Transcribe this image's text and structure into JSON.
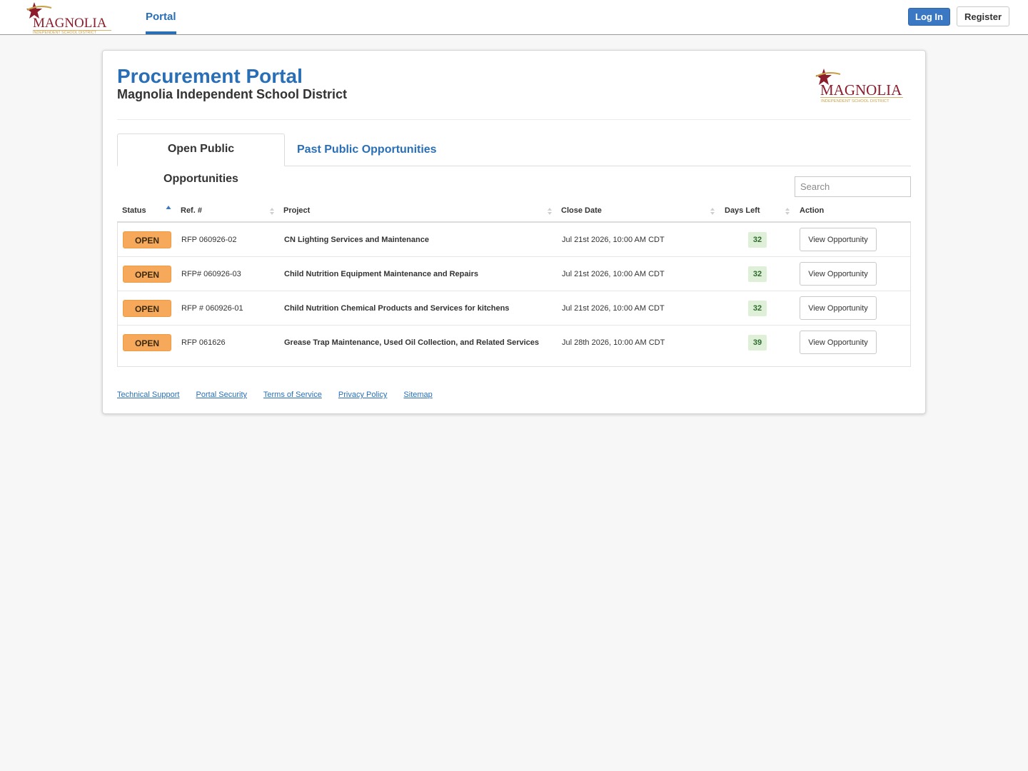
{
  "topnav": {
    "logo": {
      "name": "MAGNOLIA",
      "tagline": "INDEPENDENT SCHOOL DISTRICT"
    },
    "portal_link": "Portal",
    "login_label": "Log In",
    "register_label": "Register"
  },
  "header": {
    "title": "Procurement Portal",
    "subtitle": "Magnolia Independent School District"
  },
  "tabs": [
    {
      "label": "Open Public Opportunities",
      "active": true
    },
    {
      "label": "Past Public Opportunities",
      "active": false
    }
  ],
  "search": {
    "placeholder": "Search",
    "value": ""
  },
  "table": {
    "columns": [
      "Status",
      "Ref. #",
      "Project",
      "Close Date",
      "Days Left",
      "Action"
    ],
    "sorted_column": "Status",
    "sort_direction": "ascending",
    "rows": [
      {
        "status": "OPEN",
        "ref": "RFP 060926-02",
        "project": "CN Lighting Services and Maintenance",
        "close_date": "Jul 21st 2026, 10:00 AM CDT",
        "days_left": "32",
        "action": "View Opportunity"
      },
      {
        "status": "OPEN",
        "ref": "RFP# 060926-03",
        "project": "Child Nutrition Equipment Maintenance and Repairs",
        "close_date": "Jul 21st 2026, 10:00 AM CDT",
        "days_left": "32",
        "action": "View Opportunity"
      },
      {
        "status": "OPEN",
        "ref": "RFP # 060926-01",
        "project": "Child Nutrition Chemical Products and Services for kitchens",
        "close_date": "Jul 21st 2026, 10:00 AM CDT",
        "days_left": "32",
        "action": "View Opportunity"
      },
      {
        "status": "OPEN",
        "ref": "RFP 061626",
        "project": "Grease Trap Maintenance, Used Oil Collection, and Related Services",
        "close_date": "Jul 28th 2026, 10:00 AM CDT",
        "days_left": "39",
        "action": "View Opportunity"
      }
    ]
  },
  "footer": {
    "links": [
      "Technical Support",
      "Portal Security",
      "Terms of Service",
      "Privacy Policy",
      "Sitemap"
    ]
  },
  "colors": {
    "accent": "#2a6fb6",
    "status_open": "#f7a95b",
    "days_badge": "#dff0d8",
    "logo_maroon": "#8c1d2c",
    "logo_gold": "#c8a24a"
  }
}
